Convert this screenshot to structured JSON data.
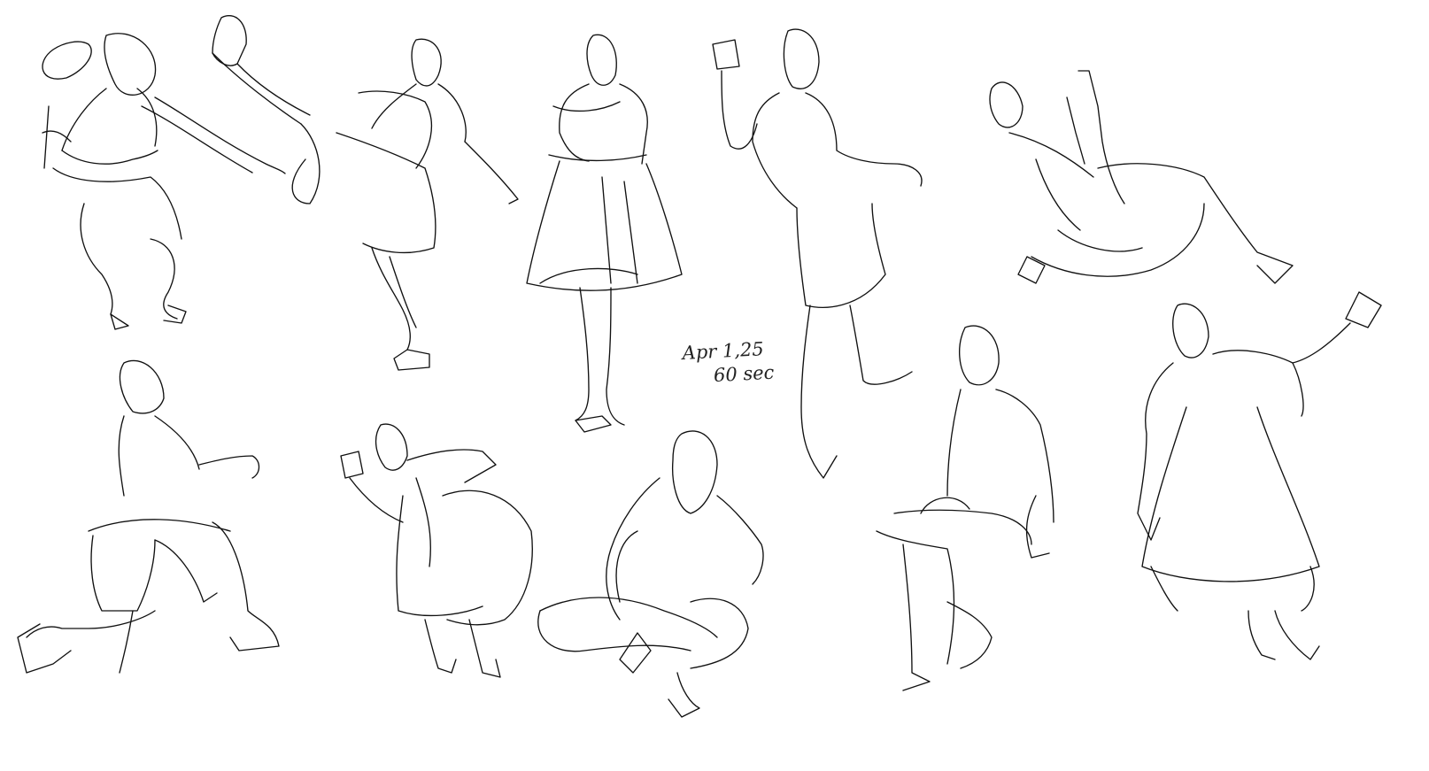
{
  "sheet": {
    "background": "#ffffff",
    "ink": "#111111",
    "annotation": {
      "date": "Apr 1,25",
      "duration": "60 sec"
    },
    "figures": [
      {
        "name": "figure-leaning-back"
      },
      {
        "name": "figure-high-kick"
      },
      {
        "name": "figure-standing-dress"
      },
      {
        "name": "figure-arm-raised"
      },
      {
        "name": "figure-floor-kick"
      },
      {
        "name": "figure-kneeling"
      },
      {
        "name": "figure-crouching-skirt"
      },
      {
        "name": "figure-sitting-cross-legged"
      },
      {
        "name": "figure-seated-crossed-legs"
      },
      {
        "name": "figure-arm-up-dress"
      }
    ]
  }
}
